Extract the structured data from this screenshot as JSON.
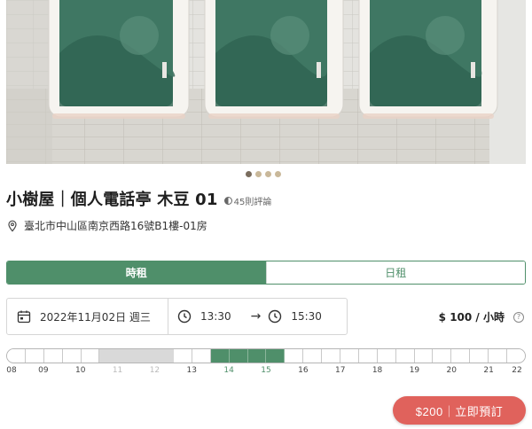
{
  "gallery": {
    "photo_icon": "phone-booth-photo",
    "dot_colors": [
      "#7a6d5e",
      "#c9b89a",
      "#c9b89a",
      "#c9b89a"
    ],
    "active_index": 0
  },
  "listing": {
    "title": "小樹屋｜個人電話亭 木豆 01",
    "rating_text": "45則評論",
    "address": "臺北市中山區南京西路16號B1樓-01房"
  },
  "tabs": [
    {
      "label": "時租",
      "active": true
    },
    {
      "label": "日租",
      "active": false
    }
  ],
  "booking": {
    "date": "2022年11月02日 週三",
    "start_time": "13:30",
    "arrow": "→",
    "end_time": "15:30",
    "price": "$ 100 / 小時",
    "help": "?"
  },
  "timeline": {
    "hours": [
      "08",
      "09",
      "10",
      "11",
      "12",
      "13",
      "14",
      "15",
      "16",
      "17",
      "18",
      "19",
      "20",
      "21",
      "22"
    ],
    "unavailable_hours": [
      "11",
      "12"
    ],
    "selected_hours": [
      "14",
      "15"
    ],
    "slots_per_hour": 2,
    "selected_range": [
      "13:30",
      "15:30"
    ],
    "unavailable_range": [
      "10:30",
      "12:30"
    ]
  },
  "cta": {
    "label": "$200｜立即預訂"
  },
  "colors": {
    "brand_green": "#4f8f6a",
    "cta_red": "#e0625c"
  }
}
